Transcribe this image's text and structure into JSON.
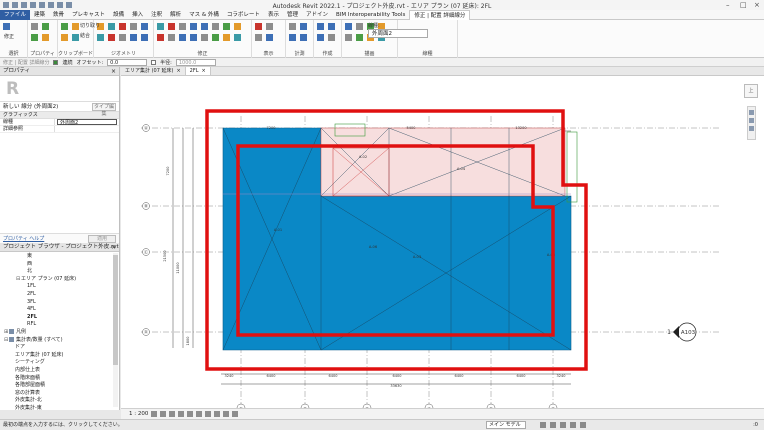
{
  "window": {
    "title": "Autodesk Revit 2022.1 - プロジェクト外皮.rvt - エリア プラン (07 延床): 2FL"
  },
  "ribbon": {
    "tabs": [
      {
        "label": "ファイル",
        "kind": "file"
      },
      {
        "label": "建築",
        "kind": ""
      },
      {
        "label": "鉄骨",
        "kind": ""
      },
      {
        "label": "プレキャスト",
        "kind": ""
      },
      {
        "label": "設備",
        "kind": ""
      },
      {
        "label": "挿入",
        "kind": ""
      },
      {
        "label": "注釈",
        "kind": ""
      },
      {
        "label": "解析",
        "kind": ""
      },
      {
        "label": "マス & 外構",
        "kind": ""
      },
      {
        "label": "コラボレート",
        "kind": ""
      },
      {
        "label": "表示",
        "kind": ""
      },
      {
        "label": "管理",
        "kind": ""
      },
      {
        "label": "アドイン",
        "kind": ""
      },
      {
        "label": "BIM Interoperability Tools",
        "kind": ""
      },
      {
        "label": "修正 | 配置 詳細線分",
        "kind": "ctx active"
      }
    ],
    "groups": [
      {
        "label": "選択",
        "width": 20
      },
      {
        "label": "プロパティ",
        "width": 22
      },
      {
        "label": "クリップボード",
        "width": 28
      },
      {
        "label": "ジオメトリ",
        "width": 52
      },
      {
        "label": "修正",
        "width": 90
      },
      {
        "label": "表示",
        "width": 26
      },
      {
        "label": "計測",
        "width": 20
      },
      {
        "label": "作成",
        "width": 20
      },
      {
        "label": "描画",
        "width": 48
      },
      {
        "label": "線種",
        "width": 60
      }
    ],
    "small_labels": {
      "modify": "修正",
      "cut": "切り取り",
      "join": "結合",
      "linestyle_label": "線種:"
    },
    "type_dropdown": "外周面2"
  },
  "options_bar": {
    "hint": "修正 | 配置 詳細線分",
    "chain_label": "連続",
    "offset_label": "オフセット:",
    "offset_value": "0.0",
    "radius_label": "半径:",
    "radius_value": "1000.0"
  },
  "properties": {
    "title": "プロパティ",
    "selector": "新しい 線分 (外周面2)",
    "edit_type": "タイプ編集",
    "category": "グラフィックス",
    "rows": [
      {
        "k": "線種",
        "v": "外周面2",
        "boxed": true
      },
      {
        "k": "詳細参照",
        "v": "",
        "boxed": false
      }
    ],
    "help": "プロパティ ヘルプ",
    "apply": "適用"
  },
  "browser": {
    "title": "プロジェクト ブラウザ - プロジェクト外皮.rvt",
    "items": [
      {
        "label": "東",
        "indent": 3,
        "tw": "",
        "sw": false,
        "bold": false
      },
      {
        "label": "西",
        "indent": 3,
        "tw": "",
        "sw": false,
        "bold": false
      },
      {
        "label": "北",
        "indent": 3,
        "tw": "",
        "sw": false,
        "bold": false
      },
      {
        "label": "エリア プラン (07 延床)",
        "indent": 2,
        "tw": "⊟",
        "sw": false,
        "bold": false
      },
      {
        "label": "1FL",
        "indent": 3,
        "tw": "",
        "sw": false,
        "bold": false
      },
      {
        "label": "2FL",
        "indent": 3,
        "tw": "",
        "sw": false,
        "bold": false
      },
      {
        "label": "3FL",
        "indent": 3,
        "tw": "",
        "sw": false,
        "bold": false
      },
      {
        "label": "4FL",
        "indent": 3,
        "tw": "",
        "sw": false,
        "bold": false
      },
      {
        "label": "2FL",
        "indent": 3,
        "tw": "",
        "sw": false,
        "bold": true
      },
      {
        "label": "RFL",
        "indent": 3,
        "tw": "",
        "sw": false,
        "bold": false
      },
      {
        "label": "凡例",
        "indent": 0,
        "tw": "⊞",
        "sw": true,
        "bold": false
      },
      {
        "label": "集計表/数量 (すべて)",
        "indent": 0,
        "tw": "⊟",
        "sw": true,
        "bold": false
      },
      {
        "label": "ドア",
        "indent": 1,
        "tw": "",
        "sw": false,
        "bold": false
      },
      {
        "label": "エリア集計 (07 延床)",
        "indent": 1,
        "tw": "",
        "sw": false,
        "bold": false
      },
      {
        "label": "シーティング",
        "indent": 1,
        "tw": "",
        "sw": false,
        "bold": false
      },
      {
        "label": "内部仕上表",
        "indent": 1,
        "tw": "",
        "sw": false,
        "bold": false
      },
      {
        "label": "各階床面積",
        "indent": 1,
        "tw": "",
        "sw": false,
        "bold": false
      },
      {
        "label": "各階部屋面積",
        "indent": 1,
        "tw": "",
        "sw": false,
        "bold": false
      },
      {
        "label": "窓の計算表",
        "indent": 1,
        "tw": "",
        "sw": false,
        "bold": false
      },
      {
        "label": "外皮集計-北",
        "indent": 1,
        "tw": "",
        "sw": false,
        "bold": false
      },
      {
        "label": "外皮集計-東",
        "indent": 1,
        "tw": "",
        "sw": false,
        "bold": false
      },
      {
        "label": "外皮集計-天井",
        "indent": 1,
        "tw": "",
        "sw": false,
        "bold": false
      }
    ]
  },
  "view_tabs": [
    {
      "label": "エリア集計 (07 延床)",
      "active": false
    },
    {
      "label": "2FL",
      "active": true
    }
  ],
  "canvas": {
    "room_labels": [
      "A-01",
      "A-02",
      "A-03",
      "A-04",
      "A-05",
      "A-06"
    ],
    "dims_top": [
      "7200",
      "5400",
      "13200"
    ],
    "dims_left": [
      "7200",
      "11000",
      "1800",
      "21500"
    ],
    "dims_bottom": [
      "3240",
      "6400",
      "6400",
      "6400",
      "6400",
      "6400",
      "3240",
      "33630"
    ],
    "grid_bottom": [
      "①",
      "②",
      "③",
      "④",
      "⑤",
      "⑥"
    ],
    "grid_left": [
      "Ⓐ",
      "Ⓑ",
      "Ⓒ",
      "Ⓓ"
    ],
    "elev_num": "1",
    "elev_tag": "A103",
    "viewcube": "上"
  },
  "view_control": {
    "scale": "1 : 200"
  },
  "status_bar": {
    "message": "最初の端点を入力するには、クリックしてください。",
    "model": "メイン モデル",
    "filter": ":0"
  },
  "colors": {
    "area_blue": "#0a88c6",
    "area_pink": "#f7dede",
    "outline_red": "#e01010"
  }
}
